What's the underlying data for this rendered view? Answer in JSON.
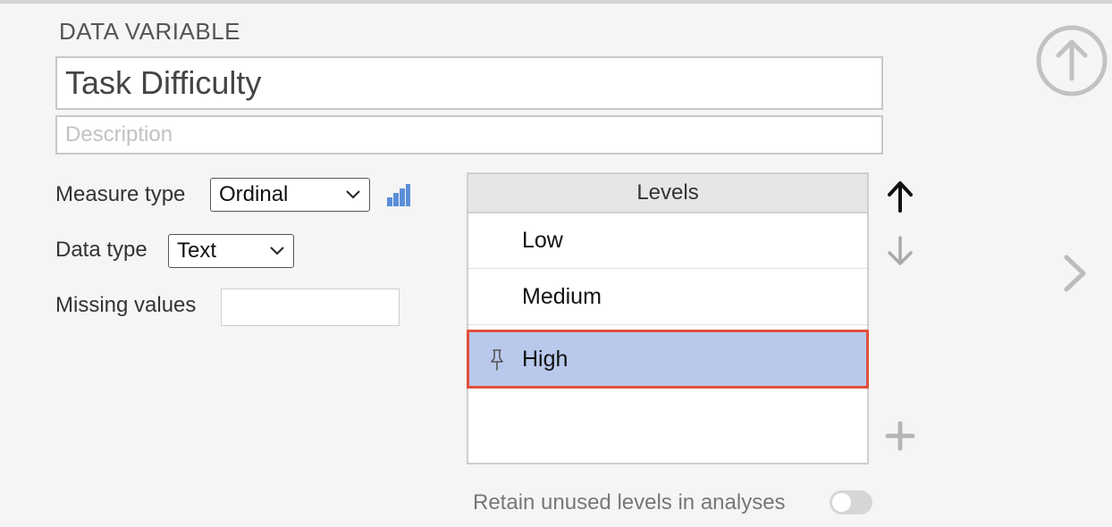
{
  "section_title": "DATA VARIABLE",
  "variable": {
    "name": "Task Difficulty",
    "description_placeholder": "Description",
    "description": ""
  },
  "measure_type": {
    "label": "Measure type",
    "value": "Ordinal",
    "icon": "ordinal-bars-icon"
  },
  "data_type": {
    "label": "Data type",
    "value": "Text"
  },
  "missing_values": {
    "label": "Missing values",
    "value": ""
  },
  "levels": {
    "header": "Levels",
    "items": [
      {
        "label": "Low",
        "pinned": false,
        "selected": false
      },
      {
        "label": "Medium",
        "pinned": false,
        "selected": false
      },
      {
        "label": "High",
        "pinned": true,
        "selected": true
      }
    ]
  },
  "retain_unused": {
    "label": "Retain unused levels in analyses",
    "enabled": false
  },
  "colors": {
    "selected_row": "#b9c9ec",
    "selected_border": "#e0503a",
    "measure_icon": "#5b8fd8"
  }
}
